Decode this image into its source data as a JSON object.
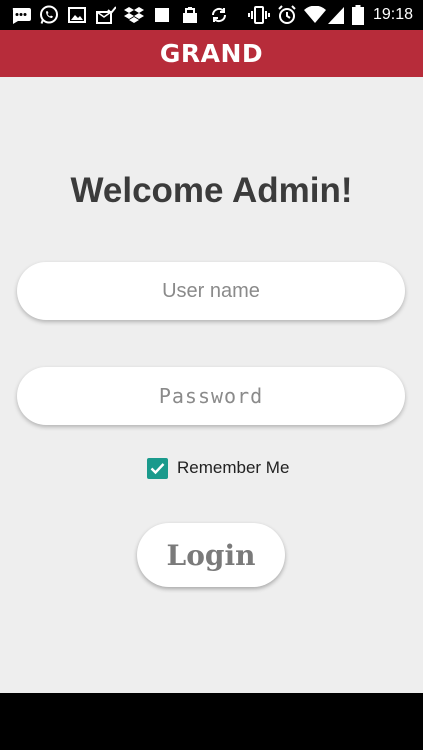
{
  "status_bar": {
    "time": "19:18",
    "icons": [
      "chat-icon",
      "whatsapp-icon",
      "image-icon",
      "mail-check-icon",
      "dropbox-icon",
      "square-icon",
      "shop-bag-icon",
      "sync-icon",
      "vibrate-icon",
      "alarm-icon",
      "wifi-icon",
      "signal-icon",
      "battery-icon"
    ]
  },
  "app_bar": {
    "brand": "GRAND",
    "color": "#b72c3a"
  },
  "login": {
    "title": "Welcome Admin!",
    "username_placeholder": "User name",
    "username_value": "",
    "password_placeholder": "Password",
    "password_value": "",
    "remember_label": "Remember Me",
    "remember_checked": true,
    "button_label": "Login"
  },
  "colors": {
    "background": "#eeeeee",
    "checkbox": "#1a9a8c"
  }
}
